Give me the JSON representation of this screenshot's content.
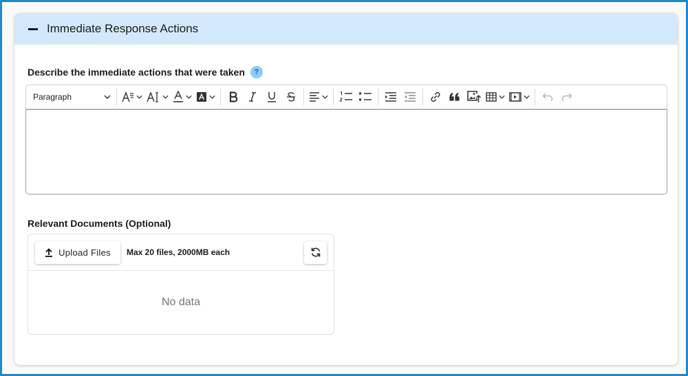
{
  "section": {
    "title": "Immediate Response Actions",
    "collapse_icon": "minus-icon"
  },
  "description_field": {
    "label": "Describe the immediate actions that were taken",
    "help_icon_text": "?",
    "value": ""
  },
  "toolbar": {
    "block_format": "Paragraph",
    "buttons": [
      "font-family-icon",
      "font-size-icon",
      "font-color-icon",
      "background-color-icon",
      "bold-icon",
      "italic-icon",
      "underline-icon",
      "strikethrough-icon",
      "align-icon",
      "numbered-list-icon",
      "bulleted-list-icon",
      "indent-icon",
      "outdent-icon",
      "link-icon",
      "blockquote-icon",
      "insert-image-icon",
      "table-icon",
      "media-icon",
      "undo-icon",
      "redo-icon"
    ]
  },
  "documents": {
    "label": "Relevant Documents (Optional)",
    "upload_button": "Upload Files",
    "hint": "Max 20 files, 2000MB each",
    "empty_text": "No data",
    "refresh_icon": "refresh-icon"
  },
  "colors": {
    "frame_border": "#1e88d0",
    "header_bg": "#d4e8fb",
    "help_icon_bg": "#90caf9"
  }
}
